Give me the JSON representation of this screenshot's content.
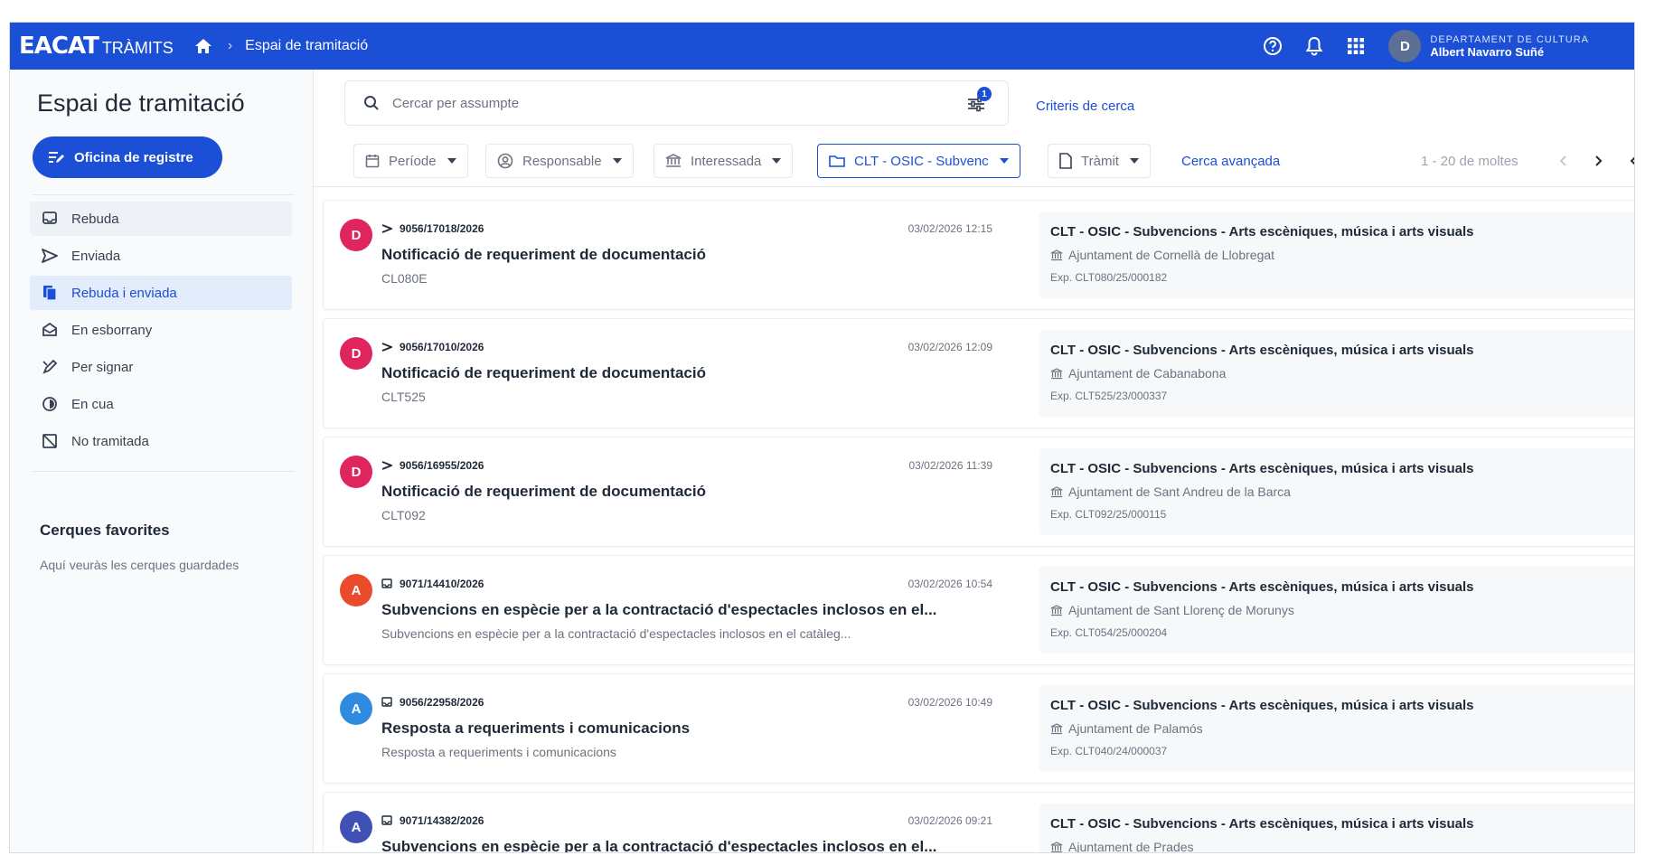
{
  "header": {
    "logo_main": "EACAT",
    "logo_sub": "TRÀMITS",
    "breadcrumb": "Espai de tramitació",
    "user_initial": "D",
    "user_department": "DEPARTAMENT DE CULTURA",
    "user_name": "Albert Navarro Suñé",
    "icons": [
      "help-icon",
      "bell-icon",
      "apps-grid-icon"
    ]
  },
  "sidebar": {
    "title": "Espai de tramitació",
    "office_button": "Oficina de registre",
    "items": [
      {
        "label": "Rebuda",
        "icon": "inbox-icon"
      },
      {
        "label": "Enviada",
        "icon": "send-icon"
      },
      {
        "label": "Rebuda i enviada",
        "icon": "files-icon"
      },
      {
        "label": "En esborrany",
        "icon": "draft-icon"
      },
      {
        "label": "Per signar",
        "icon": "sign-icon"
      },
      {
        "label": "En cua",
        "icon": "queue-icon"
      },
      {
        "label": "No tramitada",
        "icon": "not-processed-icon"
      }
    ],
    "favorites_title": "Cerques favorites",
    "favorites_hint": "Aquí veuràs les cerques guardades"
  },
  "search": {
    "placeholder": "Cercar per assumpte",
    "filter_badge": "1",
    "criteria_link": "Criteris de cerca"
  },
  "filters": {
    "period": "Període",
    "responsible": "Responsable",
    "interested": "Interessada",
    "procedure_selected": "CLT - OSIC - Subvenc",
    "procedure": "Tràmit",
    "advanced_search": "Cerca avançada",
    "pager": "1 - 20 de moltes"
  },
  "colors": {
    "brand": "#1a4fd6",
    "avatar_D": "#e0245e",
    "avatar_A_orange": "#ea4b2a",
    "avatar_A_blue": "#2f8be0",
    "avatar_A_indigo": "#3f51b5"
  },
  "records": [
    {
      "initial": "D",
      "color": "#e0245e",
      "direction": "sent",
      "ref": "9056/17018/2026",
      "date": "03/02/2026 12:15",
      "subject": "Notificació de requeriment de documentació",
      "sub": "CL080E",
      "procedure": "CLT - OSIC - Subvencions - Arts escèniques, música i arts visuals",
      "organization": "Ajuntament de Cornellà de Llobregat",
      "expedient": "Exp. CLT080/25/000182"
    },
    {
      "initial": "D",
      "color": "#e0245e",
      "direction": "sent",
      "ref": "9056/17010/2026",
      "date": "03/02/2026 12:09",
      "subject": "Notificació de requeriment de documentació",
      "sub": "CLT525",
      "procedure": "CLT - OSIC - Subvencions - Arts escèniques, música i arts visuals",
      "organization": "Ajuntament de Cabanabona",
      "expedient": "Exp. CLT525/23/000337"
    },
    {
      "initial": "D",
      "color": "#e0245e",
      "direction": "sent",
      "ref": "9056/16955/2026",
      "date": "03/02/2026 11:39",
      "subject": "Notificació de requeriment de documentació",
      "sub": "CLT092",
      "procedure": "CLT - OSIC - Subvencions - Arts escèniques, música i arts visuals",
      "organization": "Ajuntament de Sant Andreu de la Barca",
      "expedient": "Exp. CLT092/25/000115"
    },
    {
      "initial": "A",
      "color": "#ea4b2a",
      "direction": "received",
      "ref": "9071/14410/2026",
      "date": "03/02/2026 10:54",
      "subject": "Subvencions en espècie per a la contractació d'espectacles inclosos en el...",
      "sub": "Subvencions en espècie per a la contractació d'espectacles inclosos en el catàleg...",
      "procedure": "CLT - OSIC - Subvencions - Arts escèniques, música i arts visuals",
      "organization": "Ajuntament de Sant Llorenç de Morunys",
      "expedient": "Exp. CLT054/25/000204"
    },
    {
      "initial": "A",
      "color": "#2f8be0",
      "direction": "received",
      "ref": "9056/22958/2026",
      "date": "03/02/2026 10:49",
      "subject": "Resposta a requeriments i comunicacions",
      "sub": "Resposta a requeriments i comunicacions",
      "procedure": "CLT - OSIC - Subvencions - Arts escèniques, música i arts visuals",
      "organization": "Ajuntament de Palamós",
      "expedient": "Exp. CLT040/24/000037"
    },
    {
      "initial": "A",
      "color": "#3f51b5",
      "direction": "received",
      "ref": "9071/14382/2026",
      "date": "03/02/2026 09:21",
      "subject": "Subvencions en espècie per a la contractació d'espectacles inclosos en el...",
      "sub": "",
      "procedure": "CLT - OSIC - Subvencions - Arts escèniques, música i arts visuals",
      "organization": "Ajuntament de Prades",
      "expedient": ""
    }
  ]
}
